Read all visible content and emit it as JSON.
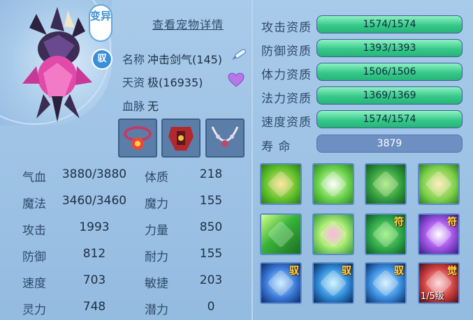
{
  "header": {
    "mutant_badge": "变异",
    "tamed_badge": "驭",
    "detail_link": "查看宠物详情"
  },
  "info": {
    "name_label": "名称",
    "name_value": "冲击剑气(145)",
    "talent_label": "天资",
    "talent_value": "极(16935)",
    "bloodline_label": "血脉",
    "bloodline_value": "无"
  },
  "equipment": [
    {
      "name": "ring-equipment"
    },
    {
      "name": "armor-equipment"
    },
    {
      "name": "necklace-equipment"
    }
  ],
  "attributes": {
    "left": [
      {
        "label": "气血",
        "value": "3880/3880"
      },
      {
        "label": "魔法",
        "value": "3460/3460"
      },
      {
        "label": "攻击",
        "value": "1993"
      },
      {
        "label": "防御",
        "value": "812"
      },
      {
        "label": "速度",
        "value": "703"
      },
      {
        "label": "灵力",
        "value": "748"
      }
    ],
    "right": [
      {
        "label": "体质",
        "value": "218"
      },
      {
        "label": "魔力",
        "value": "155"
      },
      {
        "label": "力量",
        "value": "850"
      },
      {
        "label": "耐力",
        "value": "155"
      },
      {
        "label": "敏捷",
        "value": "203"
      },
      {
        "label": "潜力",
        "value": "0"
      }
    ]
  },
  "aptitudes": [
    {
      "label": "攻击资质",
      "value": "1574/1574",
      "fill": 1.0
    },
    {
      "label": "防御资质",
      "value": "1393/1393",
      "fill": 1.0
    },
    {
      "label": "体力资质",
      "value": "1506/1506",
      "fill": 1.0
    },
    {
      "label": "法力资质",
      "value": "1369/1369",
      "fill": 1.0
    },
    {
      "label": "速度资质",
      "value": "1574/1574",
      "fill": 1.0
    }
  ],
  "lifespan": {
    "label": "寿    命",
    "value": "3879"
  },
  "skills": [
    {
      "icon": "sword-strike-icon",
      "tag": "",
      "level": ""
    },
    {
      "icon": "wing-icon",
      "tag": "",
      "level": ""
    },
    {
      "icon": "green-figure-icon",
      "tag": "",
      "level": ""
    },
    {
      "icon": "boot-icon",
      "tag": "",
      "level": ""
    },
    {
      "icon": "green-wave-icon",
      "tag": "",
      "level": ""
    },
    {
      "icon": "heart-glow-icon",
      "tag": "",
      "level": ""
    },
    {
      "icon": "muscle-figure-icon",
      "tag": "符",
      "level": ""
    },
    {
      "icon": "purple-burst-icon",
      "tag": "符",
      "level": ""
    },
    {
      "icon": "ice-blade-icon",
      "tag": "驭",
      "level": ""
    },
    {
      "icon": "ice-strike-icon",
      "tag": "驭",
      "level": ""
    },
    {
      "icon": "blue-slash-icon",
      "tag": "驭",
      "level": ""
    },
    {
      "icon": "red-crystal-icon",
      "tag": "觉",
      "level": "1/5级"
    }
  ],
  "colors": {
    "aptitude_fill": "#38c98a",
    "panel": "#a9cbea",
    "tag": "#ffd84a"
  }
}
